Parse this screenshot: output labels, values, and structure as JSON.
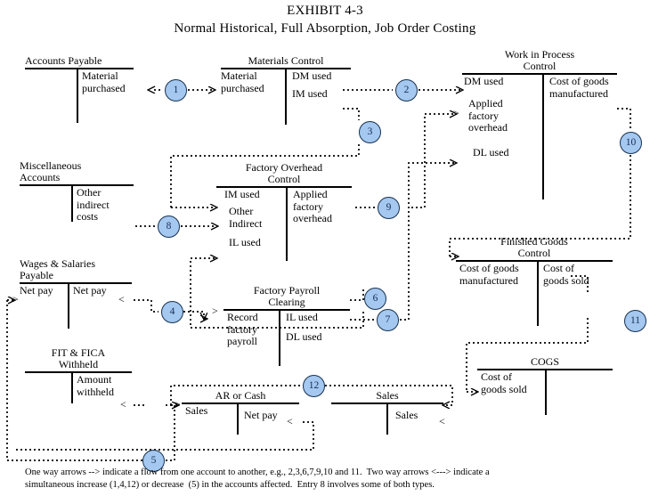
{
  "title": {
    "line1": "EXHIBIT 4-3",
    "line2": "Normal Historical, Full Absorption, Job Order Costing"
  },
  "accounts": [
    {
      "id": "accounts-payable",
      "name": "Accounts Payable",
      "debit": "",
      "credit": "Material\npurchased"
    },
    {
      "id": "materials-control",
      "name": "Materials Control",
      "debit": "Material\npurchased",
      "credit": "DM used",
      "credit2": "IM used"
    },
    {
      "id": "work-in-process-control",
      "name": "Work in Process\nControl",
      "debit": "DM used",
      "debit2": "Applied\nfactory\noverhead",
      "debit3": "DL used",
      "credit": "Cost of goods\nmanufactured"
    },
    {
      "id": "miscellaneous-accounts",
      "name": "Miscellaneous\nAccounts",
      "debit": "",
      "credit": "Other\nindirect\ncosts"
    },
    {
      "id": "factory-overhead-control",
      "name": "Factory Overhead\nControl",
      "debit": "IM used",
      "debit2": "Other\nIndirect",
      "debit3": "IL used",
      "credit": "Applied\nfactory\noverhead"
    },
    {
      "id": "finished-goods-control",
      "name": "Finished Goods\nControl",
      "debit": "Cost of goods\nmanufactured",
      "credit": "Cost of\ngoods sold"
    },
    {
      "id": "wages-salaries-payable",
      "name": "Wages & Salaries\nPayable",
      "debit": "Net pay",
      "credit": "Net pay"
    },
    {
      "id": "factory-payroll-clearing",
      "name": "Factory Payroll\nClearing",
      "debit": "Record\nfactory\npayroll",
      "credit": "IL used",
      "credit2": "DL used"
    },
    {
      "id": "fit-fica-withheld",
      "name": "FIT & FICA\nWithheld",
      "debit": "",
      "credit": "Amount\nwithheld"
    },
    {
      "id": "ar-or-cash",
      "name": "AR or Cash",
      "debit": "Sales",
      "credit": "Net pay"
    },
    {
      "id": "sales",
      "name": "Sales",
      "debit": "",
      "credit": "Sales"
    },
    {
      "id": "cogs",
      "name": "COGS",
      "debit": "Cost of\ngoods sold",
      "credit": ""
    }
  ],
  "entries": [
    {
      "n": "1"
    },
    {
      "n": "2"
    },
    {
      "n": "3"
    },
    {
      "n": "4"
    },
    {
      "n": "5"
    },
    {
      "n": "6"
    },
    {
      "n": "7"
    },
    {
      "n": "8"
    },
    {
      "n": "9"
    },
    {
      "n": "10"
    },
    {
      "n": "11"
    },
    {
      "n": "12"
    }
  ],
  "arrow_marks": {
    "right": ">",
    "left": "<",
    "one_way": "-->",
    "two_way": "<--->"
  },
  "footnote": {
    "line1": "One way arrows --> indicate a flow from one account to another, e.g., 2,3,6,7,9,10 and 11.  Two way arrows <---> indicate a",
    "line2": "simultaneous increase (1,4,12) or decrease  (5) in the accounts affected.  Entry 8 involves some of both types."
  },
  "colors": {
    "entry_fill": "#a4c8f0",
    "entry_stroke": "#17314f",
    "line": "#000000",
    "background": "#ffffff"
  }
}
